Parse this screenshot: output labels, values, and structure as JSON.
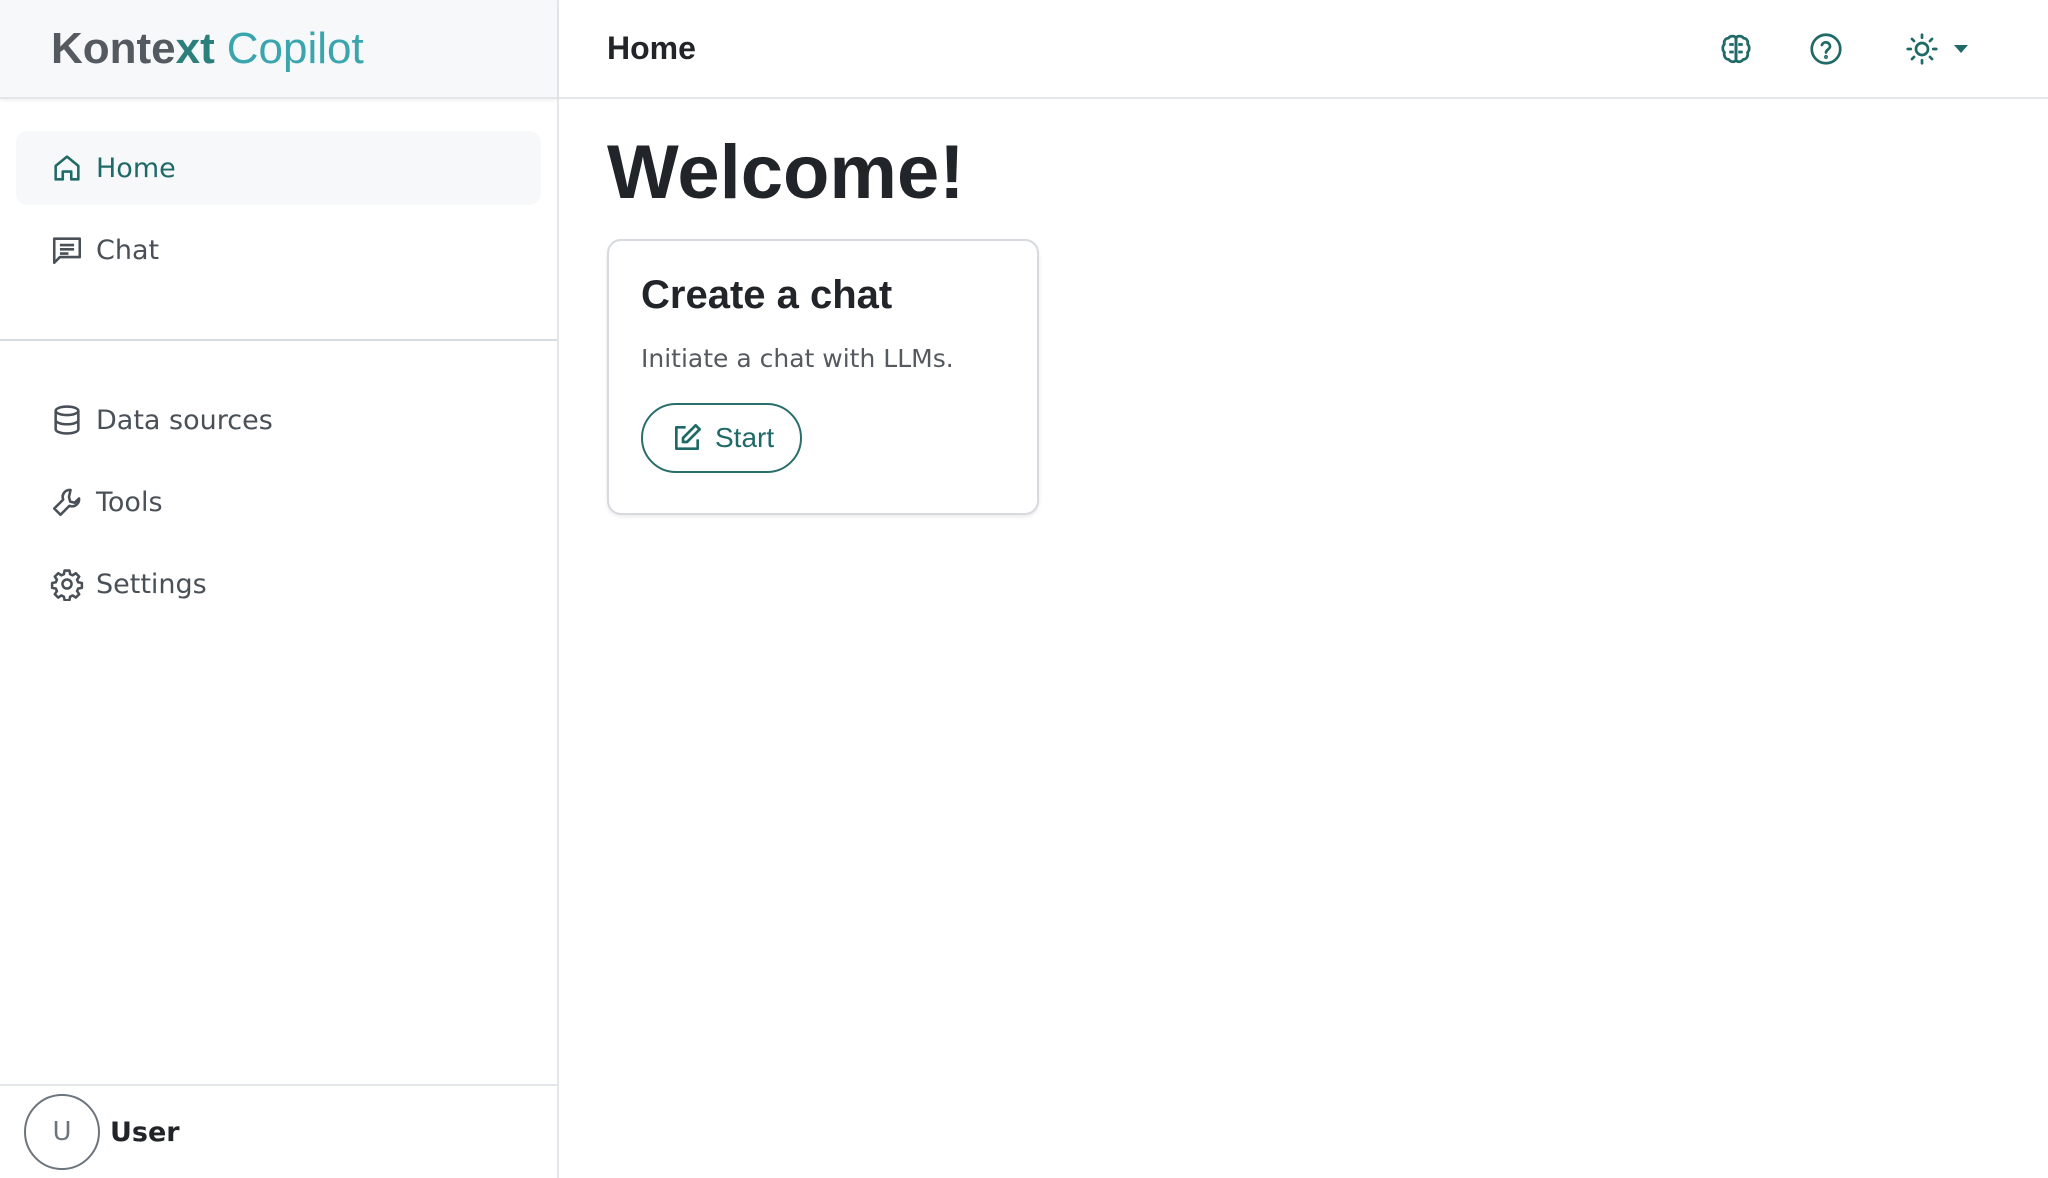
{
  "brand": {
    "part1": "Konte",
    "part2": "xt",
    "part3": "Copilot"
  },
  "sidebar": {
    "nav_primary": [
      {
        "label": "Home",
        "icon": "home-icon",
        "active": true
      },
      {
        "label": "Chat",
        "icon": "chat-icon",
        "active": false
      }
    ],
    "nav_secondary": [
      {
        "label": "Data sources",
        "icon": "database-icon"
      },
      {
        "label": "Tools",
        "icon": "wrench-icon"
      },
      {
        "label": "Settings",
        "icon": "gear-icon"
      }
    ],
    "user": {
      "initial": "U",
      "name": "User"
    }
  },
  "header": {
    "title": "Home",
    "icons": [
      "brain-icon",
      "help-circle-icon",
      "sun-icon"
    ]
  },
  "main": {
    "heading": "Welcome!",
    "card": {
      "title": "Create a chat",
      "text": "Initiate a chat with LLMs.",
      "button_label": "Start",
      "button_icon": "edit-icon"
    }
  },
  "colors": {
    "accent": "#1f6a67",
    "brand_dark": "#555a60",
    "brand_teal": "#2d7f7c",
    "brand_light": "#3aa5ad"
  }
}
